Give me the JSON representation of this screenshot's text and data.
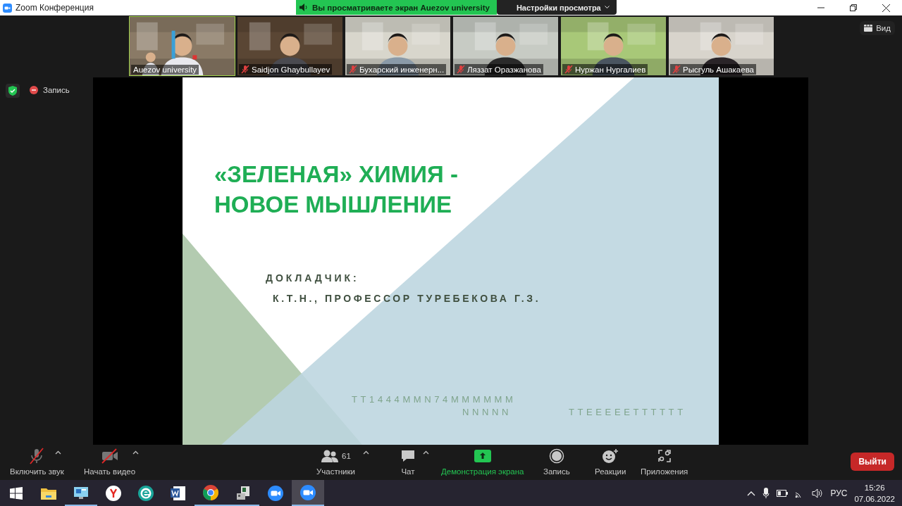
{
  "window": {
    "title": "Zoom Конференция"
  },
  "banner": {
    "message": "Вы просматриваете экран Auezov university",
    "menu": "Настройки просмотра"
  },
  "participants": [
    {
      "name": "Auezov university",
      "muted": false,
      "selected": true
    },
    {
      "name": "Saidjon Ghaybullayev",
      "muted": true,
      "selected": false
    },
    {
      "name": "Бухарский инженерн...",
      "muted": true,
      "selected": false
    },
    {
      "name": "Ляззат Оразжанова",
      "muted": true,
      "selected": false
    },
    {
      "name": "Нуржан Нургалиев",
      "muted": true,
      "selected": false
    },
    {
      "name": "Рысгуль  Ашакаева",
      "muted": true,
      "selected": false
    }
  ],
  "view_button": "Вид",
  "recording": {
    "label": "Запись"
  },
  "slide": {
    "title_lines": [
      "«ЗЕЛЕНАЯ» ХИМИЯ -",
      "НОВОЕ МЫШЛЕНИЕ"
    ],
    "speaker_label": "ДОКЛАДЧИК:",
    "speaker": "К.Т.Н., ПРОФЕССОР ТУРЕБЕКОВА Г.З.",
    "faint_lines": [
      "TT1444MMN74MMMMMM",
      "NNNNN",
      "TTEEEEETTTTTT"
    ]
  },
  "toolbar": [
    {
      "kind": "mic",
      "label": "Включить звук",
      "caret": true,
      "selected": false
    },
    {
      "kind": "video",
      "label": "Начать видео",
      "caret": true,
      "selected": false
    },
    {
      "kind": "participants",
      "label": "Участники",
      "count": "61",
      "caret": true,
      "selected": false
    },
    {
      "kind": "chat",
      "label": "Чат",
      "caret": true,
      "selected": false
    },
    {
      "kind": "share",
      "label": "Демонстрация экрана",
      "caret": false,
      "selected": true
    },
    {
      "kind": "record",
      "label": "Запись",
      "caret": false,
      "selected": false
    },
    {
      "kind": "reactions",
      "label": "Реакции",
      "caret": false,
      "selected": false
    },
    {
      "kind": "apps",
      "label": "Приложения",
      "caret": false,
      "selected": false
    }
  ],
  "leave_button": "Выйти",
  "taskbar": {
    "apps": [
      {
        "kind": "start",
        "running": false,
        "selected": false
      },
      {
        "kind": "folder",
        "running": false,
        "selected": false
      },
      {
        "kind": "monitor",
        "running": true,
        "selected": false
      },
      {
        "kind": "yandex",
        "running": false,
        "selected": false
      },
      {
        "kind": "eset",
        "running": false,
        "selected": false
      },
      {
        "kind": "word",
        "running": false,
        "selected": false
      },
      {
        "kind": "chrome",
        "running": true,
        "selected": false
      },
      {
        "kind": "server",
        "running": true,
        "selected": false
      },
      {
        "kind": "zoom",
        "running": false,
        "selected": false
      },
      {
        "kind": "zoom",
        "running": true,
        "selected": true
      }
    ],
    "language": "РУС",
    "time": "15:26",
    "date": "07.06.2022"
  }
}
